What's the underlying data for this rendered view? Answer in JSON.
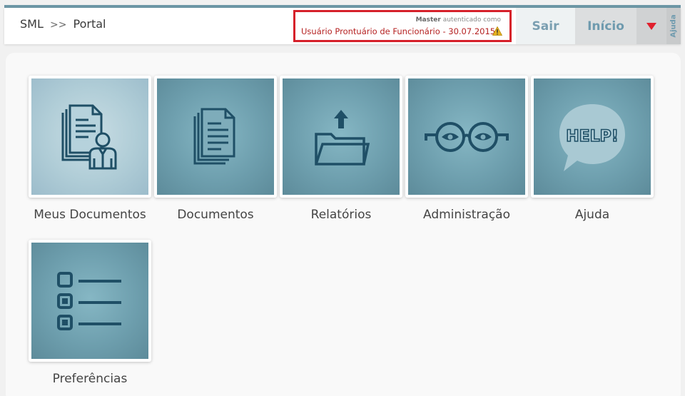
{
  "header": {
    "breadcrumb": {
      "root": "SML",
      "separator": ">>",
      "current": "Portal"
    },
    "auth": {
      "role": "Master",
      "authenticated_text": "autenticado como",
      "user": "Usuário Prontuário de Funcionário - 30.07.2015",
      "icon": "warning-icon"
    },
    "sair_label": "Sair",
    "inicio_label": "Início",
    "menu_icon": "caret-down-icon",
    "ajuda_tab": "Ajuda"
  },
  "tiles": [
    {
      "label": "Meus Documentos",
      "icon": "user-documents-icon"
    },
    {
      "label": "Documentos",
      "icon": "documents-icon"
    },
    {
      "label": "Relatórios",
      "icon": "folder-upload-icon"
    },
    {
      "label": "Administração",
      "icon": "glasses-icon"
    },
    {
      "label": "Ajuda",
      "icon": "help-bubble-icon"
    },
    {
      "label": "Preferências",
      "icon": "checklist-icon"
    }
  ],
  "colors": {
    "accent": "#6e9fae",
    "icon_stroke": "#1f4f66",
    "alert_red": "#d6202a",
    "menu_red": "#e0202d"
  }
}
